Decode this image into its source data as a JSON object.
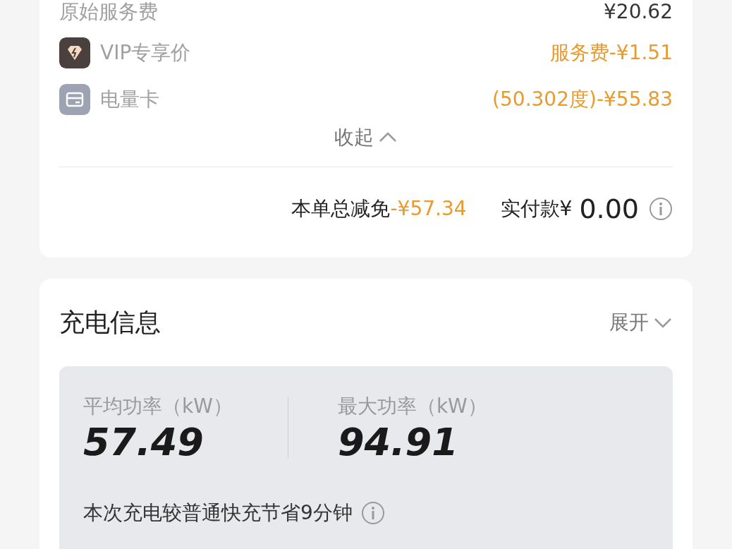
{
  "fee_details": {
    "rows": [
      {
        "kind": "plain",
        "label": "原始服务费",
        "value": "¥20.62"
      },
      {
        "kind": "vip",
        "label": "VIP专享价",
        "value": "服务费-¥1.51"
      },
      {
        "kind": "card",
        "label": "电量卡",
        "value": "(50.302度)-¥55.83"
      }
    ],
    "toggle": {
      "label": "收起",
      "expanded": true
    }
  },
  "totals": {
    "discount_label": "本单总减免",
    "discount_value": "-¥57.34",
    "paid_label": "实付款¥",
    "paid_value": "0.00"
  },
  "charging_info": {
    "title": "充电信息",
    "toggle": {
      "label": "展开",
      "expanded": false
    },
    "stats": [
      {
        "label": "平均功率（kW）",
        "value": "57.49"
      },
      {
        "label": "最大功率（kW）",
        "value": "94.91"
      }
    ],
    "note": "本次充电较普通快充节省9分钟"
  }
}
